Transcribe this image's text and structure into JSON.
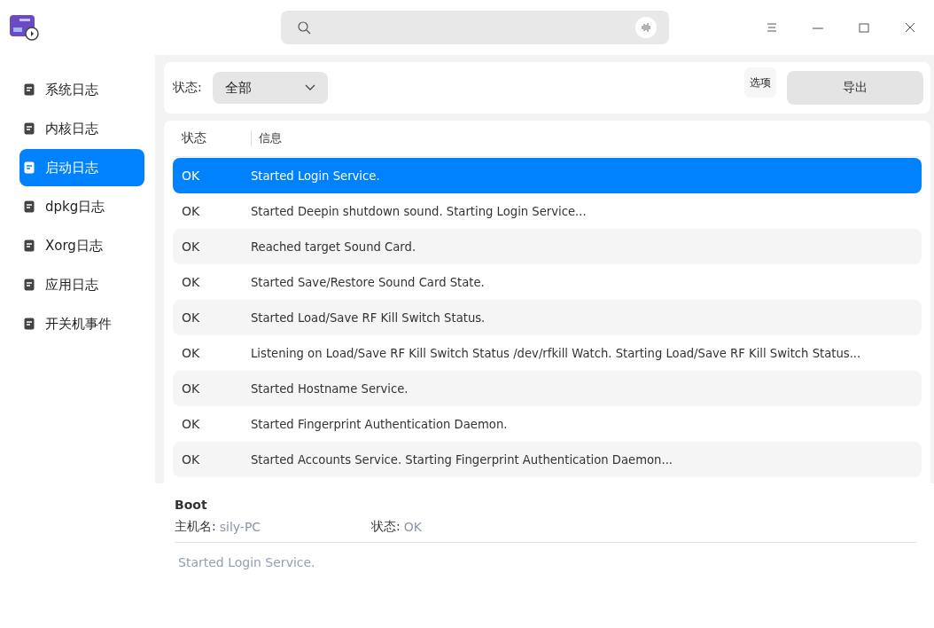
{
  "sidebar": {
    "items": [
      {
        "label": "系统日志",
        "selected": false
      },
      {
        "label": "内核日志",
        "selected": false
      },
      {
        "label": "启动日志",
        "selected": true
      },
      {
        "label": "dpkg日志",
        "selected": false
      },
      {
        "label": "Xorg日志",
        "selected": false
      },
      {
        "label": "应用日志",
        "selected": false
      },
      {
        "label": "开关机事件",
        "selected": false
      }
    ]
  },
  "toolbar": {
    "status_label": "状态:",
    "status_value": "全部",
    "options_button": "选项",
    "export_button": "导出"
  },
  "table": {
    "columns": [
      "状态",
      "信息"
    ],
    "rows": [
      {
        "status": "OK",
        "message": "Started Login Service.",
        "selected": true
      },
      {
        "status": "OK",
        "message": "Started Deepin shutdown sound. Starting Login Service...",
        "selected": false
      },
      {
        "status": "OK",
        "message": "Reached target Sound Card.",
        "selected": false
      },
      {
        "status": "OK",
        "message": "Started Save/Restore Sound Card State.",
        "selected": false
      },
      {
        "status": "OK",
        "message": "Started Load/Save RF Kill Switch Status.",
        "selected": false
      },
      {
        "status": "OK",
        "message": "Listening on Load/Save RF Kill Switch Status /dev/rfkill Watch. Starting Load/Save RF Kill Switch Status...",
        "selected": false
      },
      {
        "status": "OK",
        "message": "Started Hostname Service.",
        "selected": false
      },
      {
        "status": "OK",
        "message": "Started Fingerprint Authentication Daemon.",
        "selected": false
      },
      {
        "status": "OK",
        "message": "Started Accounts Service. Starting Fingerprint Authentication Daemon...",
        "selected": false
      }
    ]
  },
  "detail": {
    "title": "Boot",
    "host_label": "主机名:",
    "host_value": "sily-PC",
    "status_label": "状态:",
    "status_value": "OK",
    "message": "Started Login Service."
  }
}
